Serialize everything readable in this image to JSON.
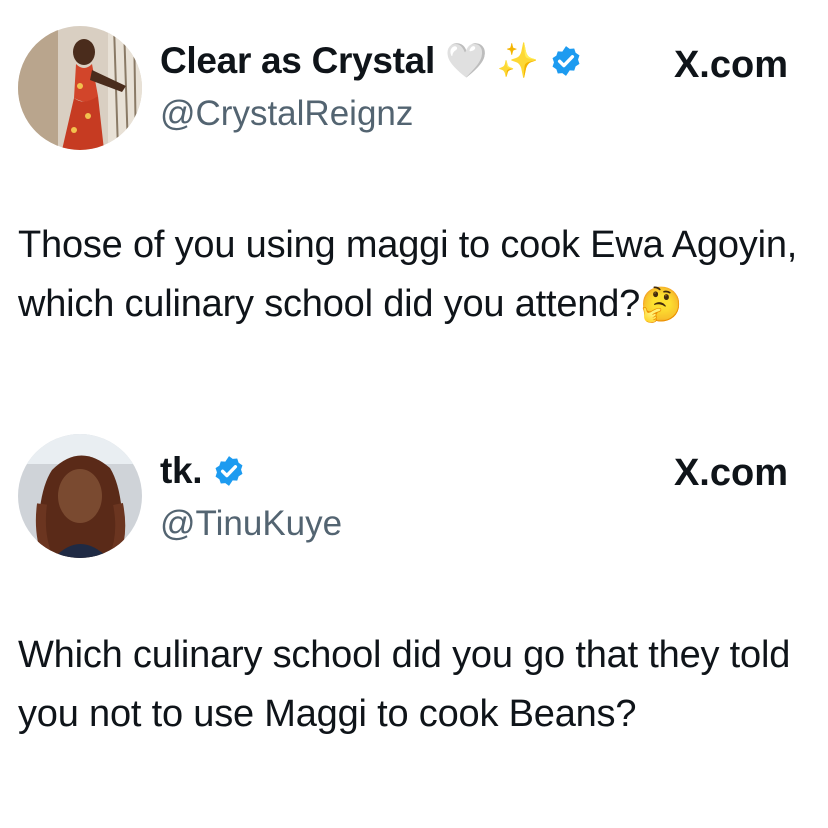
{
  "tweets": [
    {
      "display_name": "Clear as Crystal",
      "name_emojis": "🤍 ✨",
      "handle": "@CrystalReignz",
      "brand": "X.com",
      "text": "Those of you using maggi to cook Ewa Agoyin, which culinary school did you attend?",
      "text_emoji": "🤔",
      "verified": true
    },
    {
      "display_name": "tk.",
      "handle": "@TinuKuye",
      "brand": "X.com",
      "text": "Which culinary school did you go that they told you not to use Maggi to cook Beans?",
      "verified": true
    }
  ],
  "colors": {
    "verified_badge": "#1d9bf0",
    "handle": "#536471",
    "text": "#0f1419"
  }
}
